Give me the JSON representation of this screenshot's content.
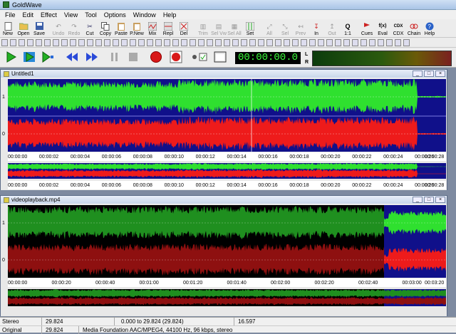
{
  "app": {
    "title": "GoldWave"
  },
  "menu": [
    "File",
    "Edit",
    "Effect",
    "View",
    "Tool",
    "Options",
    "Window",
    "Help"
  ],
  "toolbar": [
    {
      "label": "New",
      "icon": "new-icon"
    },
    {
      "label": "Open",
      "icon": "open-icon"
    },
    {
      "label": "Save",
      "icon": "save-icon"
    },
    {
      "label": "Undo",
      "icon": "undo-icon"
    },
    {
      "label": "Redo",
      "icon": "redo-icon"
    },
    {
      "label": "Cut",
      "icon": "cut-icon"
    },
    {
      "label": "Copy",
      "icon": "copy-icon"
    },
    {
      "label": "Paste",
      "icon": "paste-icon"
    },
    {
      "label": "P.New",
      "icon": "paste-new-icon"
    },
    {
      "label": "Mix",
      "icon": "mix-icon"
    },
    {
      "label": "Repl",
      "icon": "replace-icon"
    },
    {
      "label": "Del",
      "icon": "delete-icon"
    },
    {
      "label": "Trim",
      "icon": "trim-icon"
    },
    {
      "label": "Sel Vw",
      "icon": "select-view-icon"
    },
    {
      "label": "Sel All",
      "icon": "select-all-icon"
    },
    {
      "label": "Set",
      "icon": "set-icon"
    },
    {
      "label": "All",
      "icon": "zoom-all-icon"
    },
    {
      "label": "Sel",
      "icon": "zoom-sel-icon"
    },
    {
      "label": "Prev",
      "icon": "zoom-prev-icon"
    },
    {
      "label": "In",
      "icon": "zoom-in-icon"
    },
    {
      "label": "Out",
      "icon": "zoom-out-icon"
    },
    {
      "label": "1:1",
      "icon": "zoom-1-1-icon"
    },
    {
      "label": "Cues",
      "icon": "cues-icon"
    },
    {
      "label": "Eval",
      "icon": "eval-icon"
    },
    {
      "label": "CDX",
      "icon": "cdx-icon"
    },
    {
      "label": "Chain",
      "icon": "chain-icon"
    },
    {
      "label": "Help",
      "icon": "help-icon"
    }
  ],
  "eval_text": "f(x)",
  "cdx_text": "CDX",
  "clock": "00:00:00.0",
  "meter": {
    "left": "L",
    "right": "R"
  },
  "window1": {
    "title": "Untitled1",
    "ticks": [
      "00:00:00",
      "00:00:02",
      "00:00:04",
      "00:00:06",
      "00:00:08",
      "00:00:10",
      "00:00:12",
      "00:00:14",
      "00:00:16",
      "00:00:18",
      "00:00:20",
      "00:00:22",
      "00:00:24",
      "00:00:26",
      "00:00:28"
    ],
    "channel_labels": [
      "1",
      "0",
      "1",
      "0"
    ]
  },
  "window2": {
    "title": "videoplayback.mp4",
    "ticks": [
      "00:00:00",
      "00:00:20",
      "00:00:40",
      "00:01:00",
      "00:01:20",
      "00:01:40",
      "00:02:00",
      "00:02:20",
      "00:02:40",
      "00:03:00",
      "00:03:20"
    ],
    "channel_labels": [
      "1",
      "0",
      "1",
      "0"
    ]
  },
  "status": {
    "row1": {
      "channels": "Stereo",
      "length": "29.824",
      "selection": "0.000 to 29.824 (29.824)",
      "position": "16.597"
    },
    "row2": {
      "label": "Original",
      "length": "29.824",
      "format": "Media Foundation AAC/MPEG4, 44100 Hz, 96 kbps, stereo"
    }
  },
  "colors": {
    "left_wave": "#2fe02f",
    "right_wave": "#ee1b1b",
    "wave_bg": "#10108a",
    "wave_bg_unsel": "#000000"
  }
}
